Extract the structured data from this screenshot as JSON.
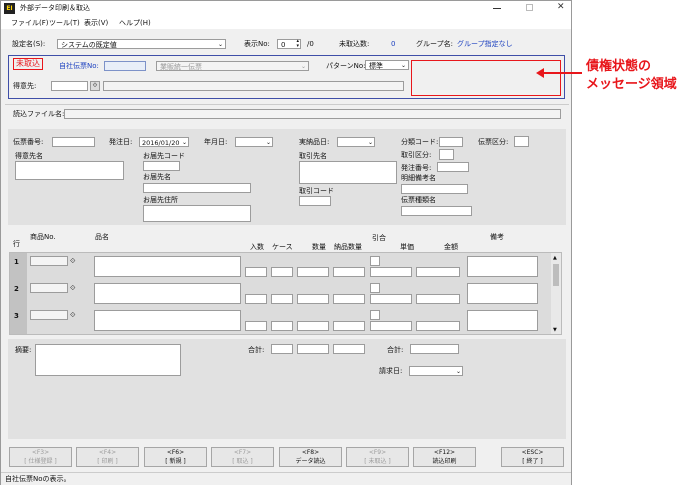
{
  "window": {
    "title": "外部データ印刷＆取込",
    "app_icon": "EI"
  },
  "menu": [
    "ファイル(F)",
    "ツール(T)",
    "表示(V)",
    "ヘルプ(H)"
  ],
  "header": {
    "settings_label": "設定名(S):",
    "settings_value": "システムの既定値",
    "display_no_label": "表示No:",
    "display_no_value": "0",
    "display_no_total": "/0",
    "unimported_label": "未取込数:",
    "unimported_value": "0",
    "group_label": "グループ名:",
    "group_value": "グループ指定なし"
  },
  "status_box": {
    "badge": "未取込",
    "own_slip_label": "自社伝票No:",
    "slip_type": "業販統一伝票",
    "pattern_label": "パターンNo:",
    "pattern_value": "標準",
    "customer_label": "得意先:"
  },
  "annotation": "債権状態の\nメッセージ領域",
  "file_label": "読込ファイル名:",
  "form": {
    "slip_no": "伝票番号:",
    "order_date": "発注日:",
    "order_date_value": "2016/01/20",
    "year_month": "年月日:",
    "delivery_item": "実納品日:",
    "class_code": "分類コード:",
    "slip_class": "伝票区分:",
    "customer_name": "得意先名",
    "dest_code": "お届先コード",
    "dest_name": "お届先名",
    "dest_addr": "お届先住所",
    "trading_name": "取引先名",
    "trading_code": "取引コード",
    "trade_class": "取引区分:",
    "order_no": "発注番号:",
    "detail_remarks": "明細備考名",
    "slip_type_name": "伝票種類名"
  },
  "detail": {
    "row_col": "行",
    "product_no": "商品No.",
    "product_name": "品名",
    "in_qty": "入数",
    "case": "ケース",
    "qty": "数量",
    "delivery_qty": "納品数量",
    "discount": "引合",
    "unit_price": "単価",
    "amount": "金額",
    "remarks": "備考",
    "rows": [
      "1",
      "2",
      "3"
    ]
  },
  "footer": {
    "summary": "摘要:",
    "total1": "合計:",
    "total2": "合計:",
    "bill_date": "請求日:"
  },
  "buttons": [
    {
      "key": "<F3>",
      "label": "[ 仕様登録 ]",
      "enabled": false
    },
    {
      "key": "<F4>",
      "label": "[ 印刷 ]",
      "enabled": false
    },
    {
      "key": "<F6>",
      "label": "[ 新規 ]",
      "enabled": true
    },
    {
      "key": "<F7>",
      "label": "[ 取込 ]",
      "enabled": false
    },
    {
      "key": "<F8>",
      "label": "データ読込",
      "enabled": true
    },
    {
      "key": "<F9>",
      "label": "[ 未取込 ]",
      "enabled": false
    },
    {
      "key": "<F12>",
      "label": "読込印刷",
      "enabled": true
    },
    {
      "key": "<ESC>",
      "label": "[ 終了 ]",
      "enabled": true
    }
  ],
  "statusbar": "自社伝票Noの表示。",
  "colors": {
    "accent": "#e8161b",
    "frame": "#3f4fa8",
    "blue_text": "#1a3fbf"
  }
}
